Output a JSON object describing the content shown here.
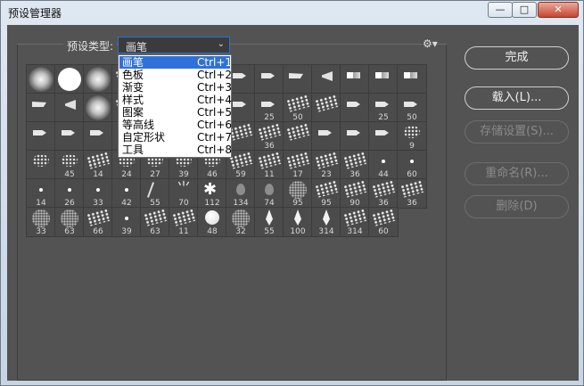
{
  "window": {
    "title": "预设管理器",
    "min_glyph": "—",
    "max_glyph": "□",
    "close_glyph": "✕"
  },
  "preset": {
    "label": "预设类型:",
    "selected": "画笔",
    "arrow": "⌄",
    "gear": "⚙▾"
  },
  "dropdown": [
    {
      "label": "画笔",
      "shortcut": "Ctrl+1"
    },
    {
      "label": "色板",
      "shortcut": "Ctrl+2"
    },
    {
      "label": "渐变",
      "shortcut": "Ctrl+3"
    },
    {
      "label": "样式",
      "shortcut": "Ctrl+4"
    },
    {
      "label": "图案",
      "shortcut": "Ctrl+5"
    },
    {
      "label": "等高线",
      "shortcut": "Ctrl+6"
    },
    {
      "label": "自定形状",
      "shortcut": "Ctrl+7"
    },
    {
      "label": "工具",
      "shortcut": "Ctrl+8"
    }
  ],
  "buttons": {
    "done": "完成",
    "load": "载入(L)...",
    "save": "存储设置(S)...",
    "rename": "重命名(R)...",
    "delete": "删除(D)"
  },
  "brushes": [
    [
      "",
      "",
      "",
      "",
      "",
      "",
      "",
      "",
      "",
      "",
      "",
      "",
      "",
      "",
      "",
      "",
      "",
      "",
      "",
      "",
      "",
      "",
      "25",
      "50",
      "",
      "",
      "25",
      "50",
      "",
      "",
      "",
      "",
      "",
      "",
      "",
      "",
      "36",
      "",
      "",
      "",
      "",
      "9",
      "",
      "45",
      "14",
      "24",
      "27",
      "39",
      "46",
      "59",
      "11",
      "17",
      "23",
      "36",
      "44",
      "60",
      "14",
      "26",
      "33",
      "42",
      "55",
      "70",
      "112",
      "134",
      "74",
      "95",
      "95",
      "90",
      "36",
      "36",
      "33",
      "63",
      "66",
      "39",
      "63",
      "11",
      "48",
      "32",
      "55",
      "100",
      "314",
      "314",
      "60"
    ]
  ]
}
